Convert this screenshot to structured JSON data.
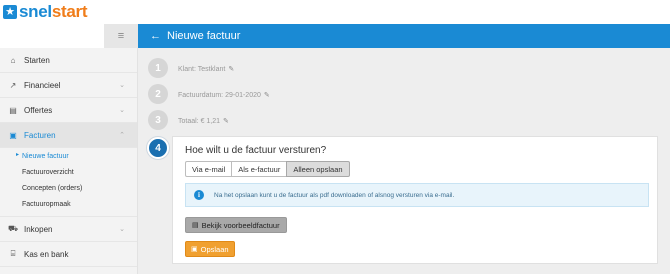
{
  "brand": {
    "part1": "snel",
    "part2": "start",
    "accent": "#1a8ad4",
    "accent2": "#f07d1a"
  },
  "sidebar": {
    "menu_icon": "hamburger-icon",
    "items": [
      {
        "label": "Starten",
        "icon": "home-icon"
      },
      {
        "label": "Financieel",
        "icon": "chart-icon"
      },
      {
        "label": "Offertes",
        "icon": "document-icon"
      },
      {
        "label": "Facturen",
        "icon": "invoice-icon"
      },
      {
        "label": "Inkopen",
        "icon": "cart-icon"
      },
      {
        "label": "Kas en bank",
        "icon": "bank-icon"
      }
    ],
    "facturen_sub": [
      {
        "label": "Nieuwe factuur"
      },
      {
        "label": "Factuuroverzicht"
      },
      {
        "label": "Concepten (orders)"
      },
      {
        "label": "Factuuropmaak"
      }
    ]
  },
  "header": {
    "title": "Nieuwe factuur",
    "back_icon": "arrow-left-icon"
  },
  "steps": [
    {
      "num": "1",
      "text": "Klant: Testklant"
    },
    {
      "num": "2",
      "text": "Factuurdatum: 29-01-2020"
    },
    {
      "num": "3",
      "text": "Totaal: € 1,21"
    },
    {
      "num": "4",
      "text": ""
    }
  ],
  "send": {
    "question": "Hoe wilt u de factuur versturen?",
    "options": [
      "Via e-mail",
      "Als e-factuur",
      "Alleen opslaan"
    ],
    "selected": "Alleen opslaan",
    "info": "Na het opslaan kunt u de factuur als pdf downloaden of alsnog versturen via e-mail.",
    "preview_label": "Bekijk voorbeeldfactuur",
    "save_label": "Opslaan"
  }
}
